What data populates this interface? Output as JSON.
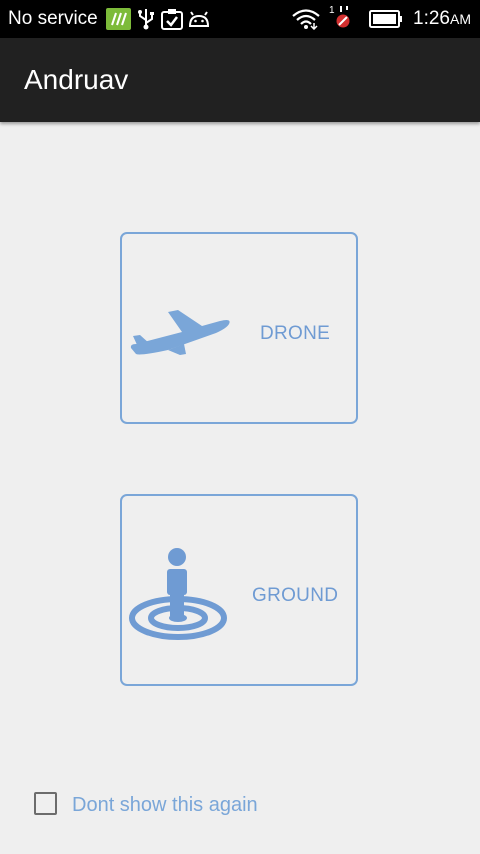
{
  "status_bar": {
    "carrier": "No service",
    "sim_badge": "1",
    "time": "1:26",
    "ampm": "AM",
    "icons": [
      "app-notification-icon",
      "usb-icon",
      "clipboard-check-icon",
      "android-debug-icon",
      "wifi-icon",
      "sim-blocked-icon",
      "battery-icon"
    ]
  },
  "action_bar": {
    "title": "Andruav"
  },
  "choices": {
    "drone": {
      "label": "DRONE",
      "icon": "airplane-icon"
    },
    "ground": {
      "label": "GROUND",
      "icon": "ground-unit-icon"
    }
  },
  "footer": {
    "checkbox_label": "Dont show this again",
    "checked": false
  },
  "colors": {
    "accent": "#7aa6d8",
    "icon_blue": "#6f9bd3",
    "background": "#efefef",
    "action_bar": "#212121",
    "status_bar": "#000000"
  }
}
